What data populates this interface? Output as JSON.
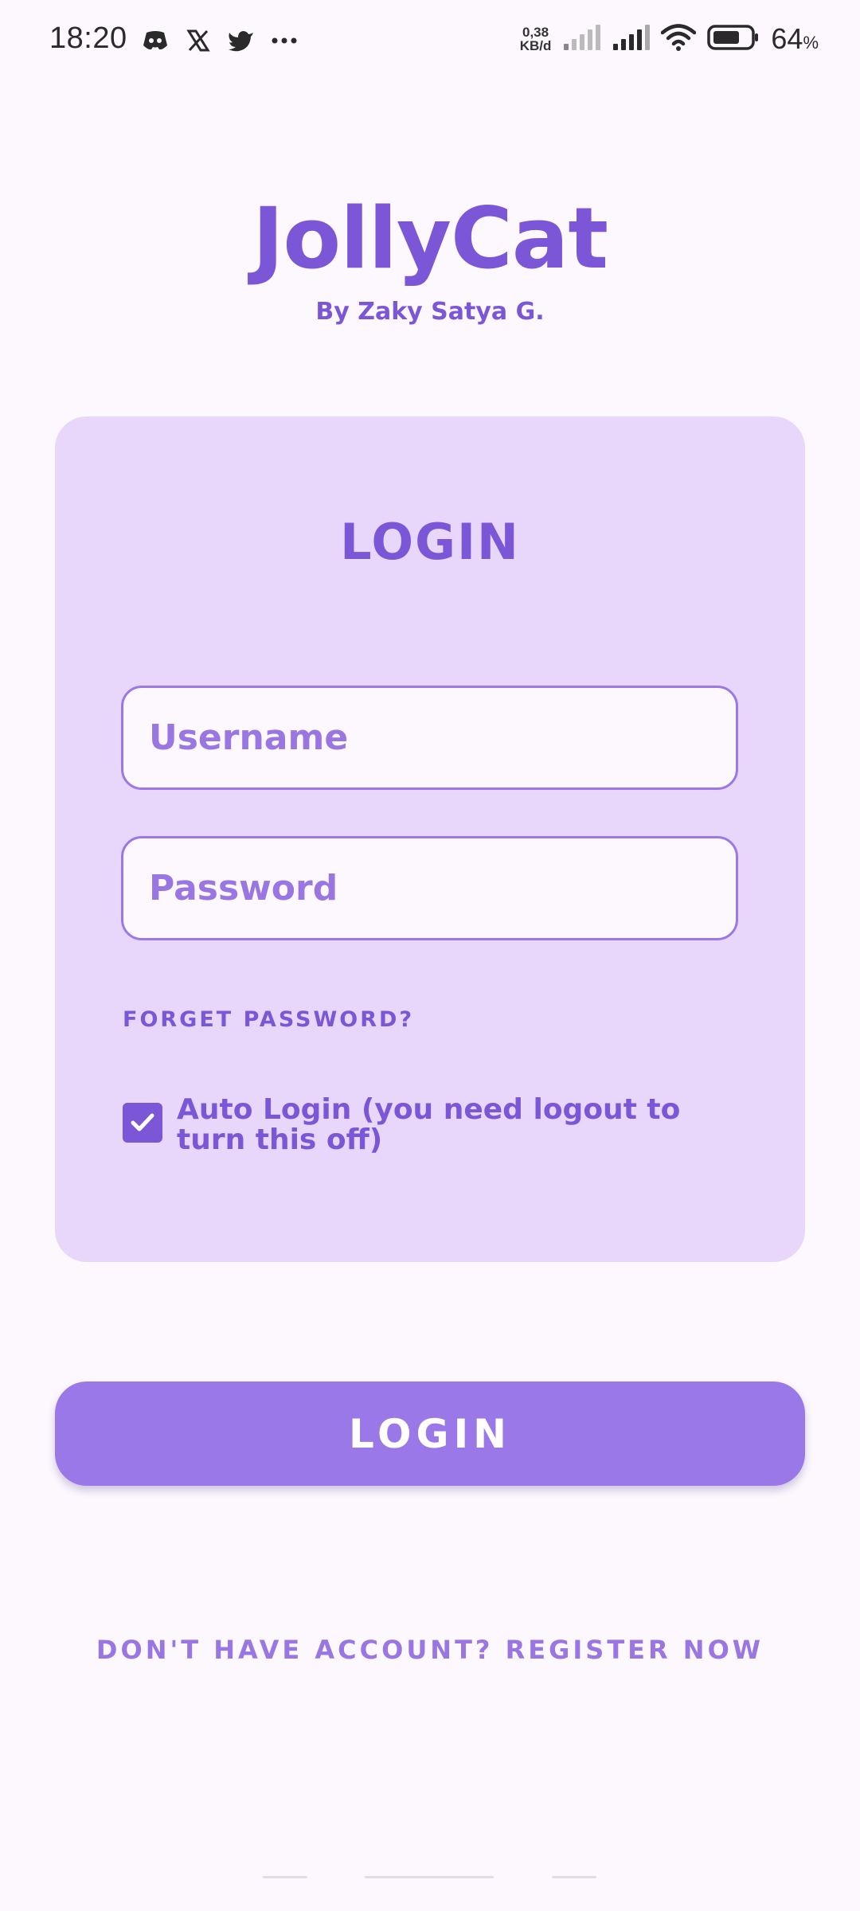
{
  "status_bar": {
    "time": "18:20",
    "notification_icons": [
      "discord-icon",
      "x-icon",
      "twitter-icon",
      "more-icon"
    ],
    "net_speed_value": "0,38",
    "net_speed_unit": "KB/d",
    "battery_percent": "64",
    "battery_unit": "%"
  },
  "header": {
    "app_title": "JollyCat",
    "subtitle": "By Zaky Satya G."
  },
  "login_card": {
    "title": "LOGIN",
    "username_placeholder": "Username",
    "password_placeholder": "Password",
    "forget_password": "FORGET PASSWORD?",
    "auto_login_label": "Auto Login (you need logout to turn this off)",
    "auto_login_checked": true
  },
  "login_button": {
    "label": "LOGIN"
  },
  "register": {
    "label": "DON'T HAVE ACCOUNT? REGISTER NOW"
  },
  "colors": {
    "background": "#FCF8FE",
    "card": "#E8D7FB",
    "accent": "#7B56D6",
    "button": "#9B78E8",
    "placeholder": "#9A76E2"
  }
}
